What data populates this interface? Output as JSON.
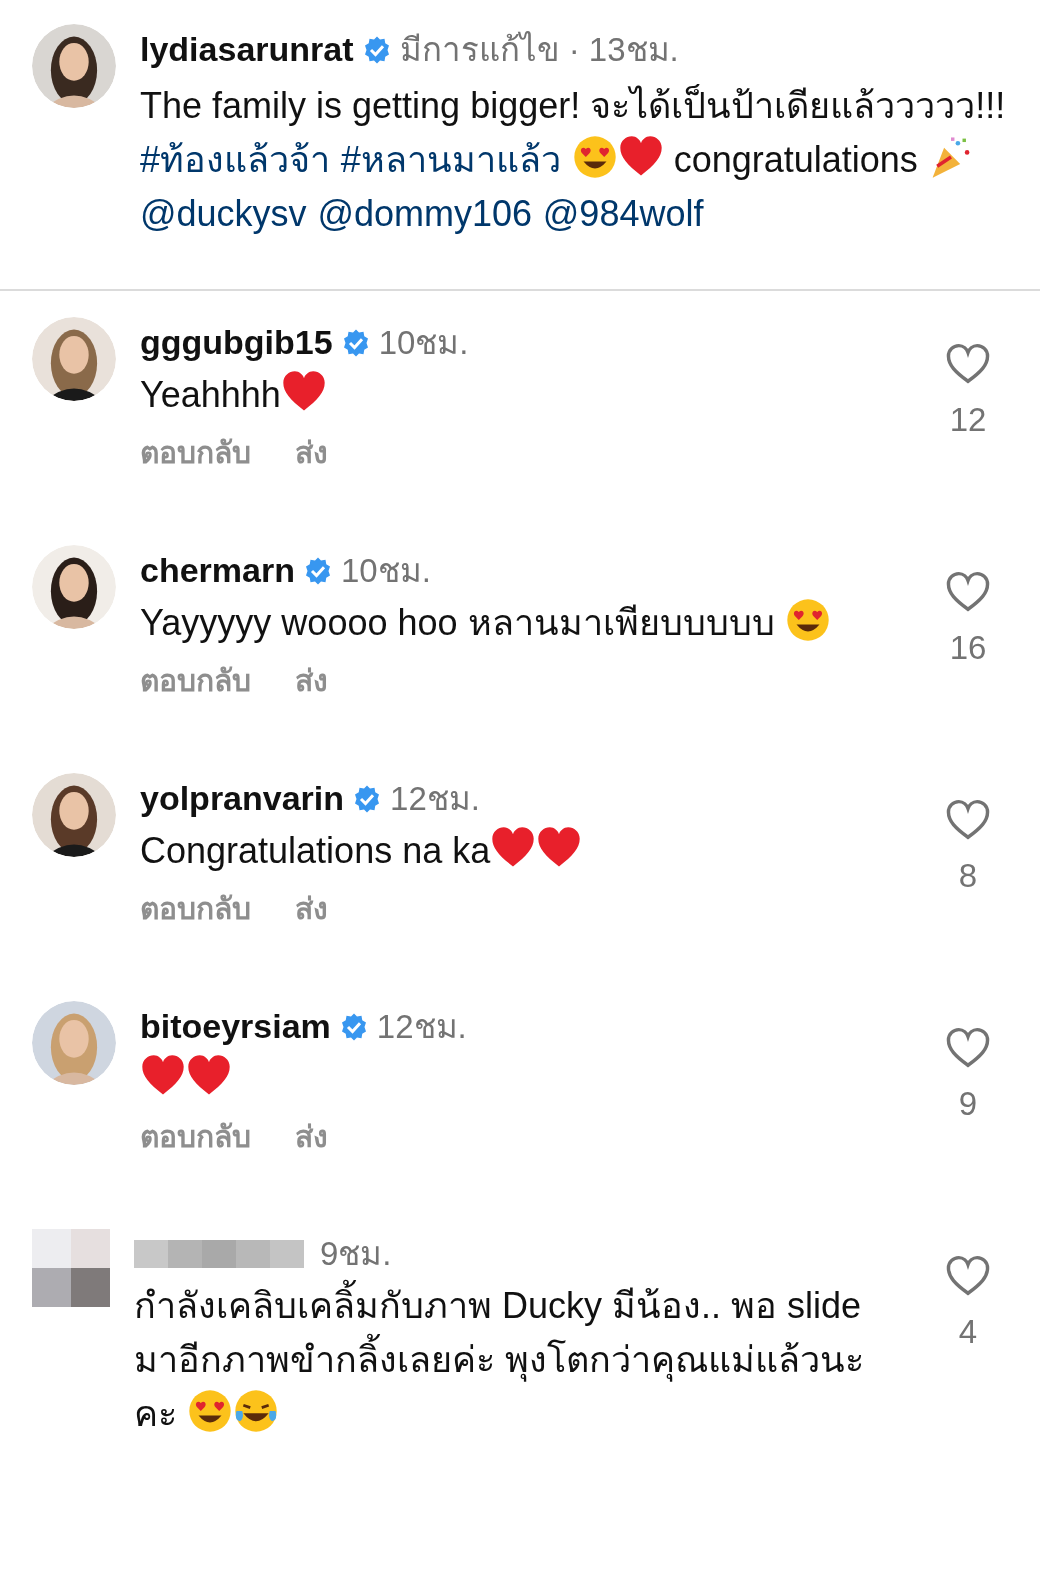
{
  "post": {
    "username": "lydiasarunrat",
    "verified": true,
    "meta": "มีการแก้ไข · 13ชม.",
    "body": [
      {
        "kind": "text",
        "text": "The family is getting bigger! จะได้เป็นป้าเดียแล้ววววว!!! "
      },
      {
        "kind": "link",
        "text": "#ท้องแล้วจ้า",
        "spaced": true
      },
      {
        "kind": "link",
        "text": "#หลานมาแล้ว",
        "spaced": true
      },
      {
        "kind": "heart-eyes"
      },
      {
        "kind": "heart"
      },
      {
        "kind": "text",
        "text": " congratulations "
      },
      {
        "kind": "party",
        "spaced": true
      },
      {
        "kind": "link",
        "text": "@duckysv",
        "spaced": true
      },
      {
        "kind": "link",
        "text": "@dommy106",
        "spaced": true
      },
      {
        "kind": "link",
        "text": "@984wolf"
      }
    ]
  },
  "comments": [
    {
      "username": "gggubgib15",
      "verified": true,
      "redacted": false,
      "time": "10ชม.",
      "likes": "12",
      "actions": [
        "ตอบกลับ",
        "ส่ง"
      ],
      "body": [
        {
          "kind": "text",
          "text": "Yeahhhh"
        },
        {
          "kind": "heart"
        }
      ]
    },
    {
      "username": "chermarn",
      "verified": true,
      "redacted": false,
      "time": "10ชม.",
      "likes": "16",
      "actions": [
        "ตอบกลับ",
        "ส่ง"
      ],
      "body": [
        {
          "kind": "text",
          "text": "Yayyyyy woooo hoo หลานมาเพียบบบบบ "
        },
        {
          "kind": "heart-eyes"
        }
      ]
    },
    {
      "username": "yolpranvarin",
      "verified": true,
      "redacted": false,
      "time": "12ชม.",
      "likes": "8",
      "actions": [
        "ตอบกลับ",
        "ส่ง"
      ],
      "body": [
        {
          "kind": "text",
          "text": "Congratulations na ka"
        },
        {
          "kind": "heart"
        },
        {
          "kind": "heart"
        }
      ]
    },
    {
      "username": "bitoeyrsiam",
      "verified": true,
      "redacted": false,
      "time": "12ชม.",
      "likes": "9",
      "actions": [
        "ตอบกลับ",
        "ส่ง"
      ],
      "body": [
        {
          "kind": "heart"
        },
        {
          "kind": "heart"
        }
      ]
    },
    {
      "verified": false,
      "redacted": true,
      "time": "9ชม.",
      "likes": "4",
      "body": [
        {
          "kind": "text",
          "text": "กำลังเคลิบเคลิ้มกับภาพ Ducky มีน้อง.. พอ slide มาอีกภาพขำกลิ้งเลยค่ะ พุงโตกว่าคุณแม่แล้วนะคะ "
        },
        {
          "kind": "heart-eyes"
        },
        {
          "kind": "laugh"
        }
      ]
    }
  ]
}
